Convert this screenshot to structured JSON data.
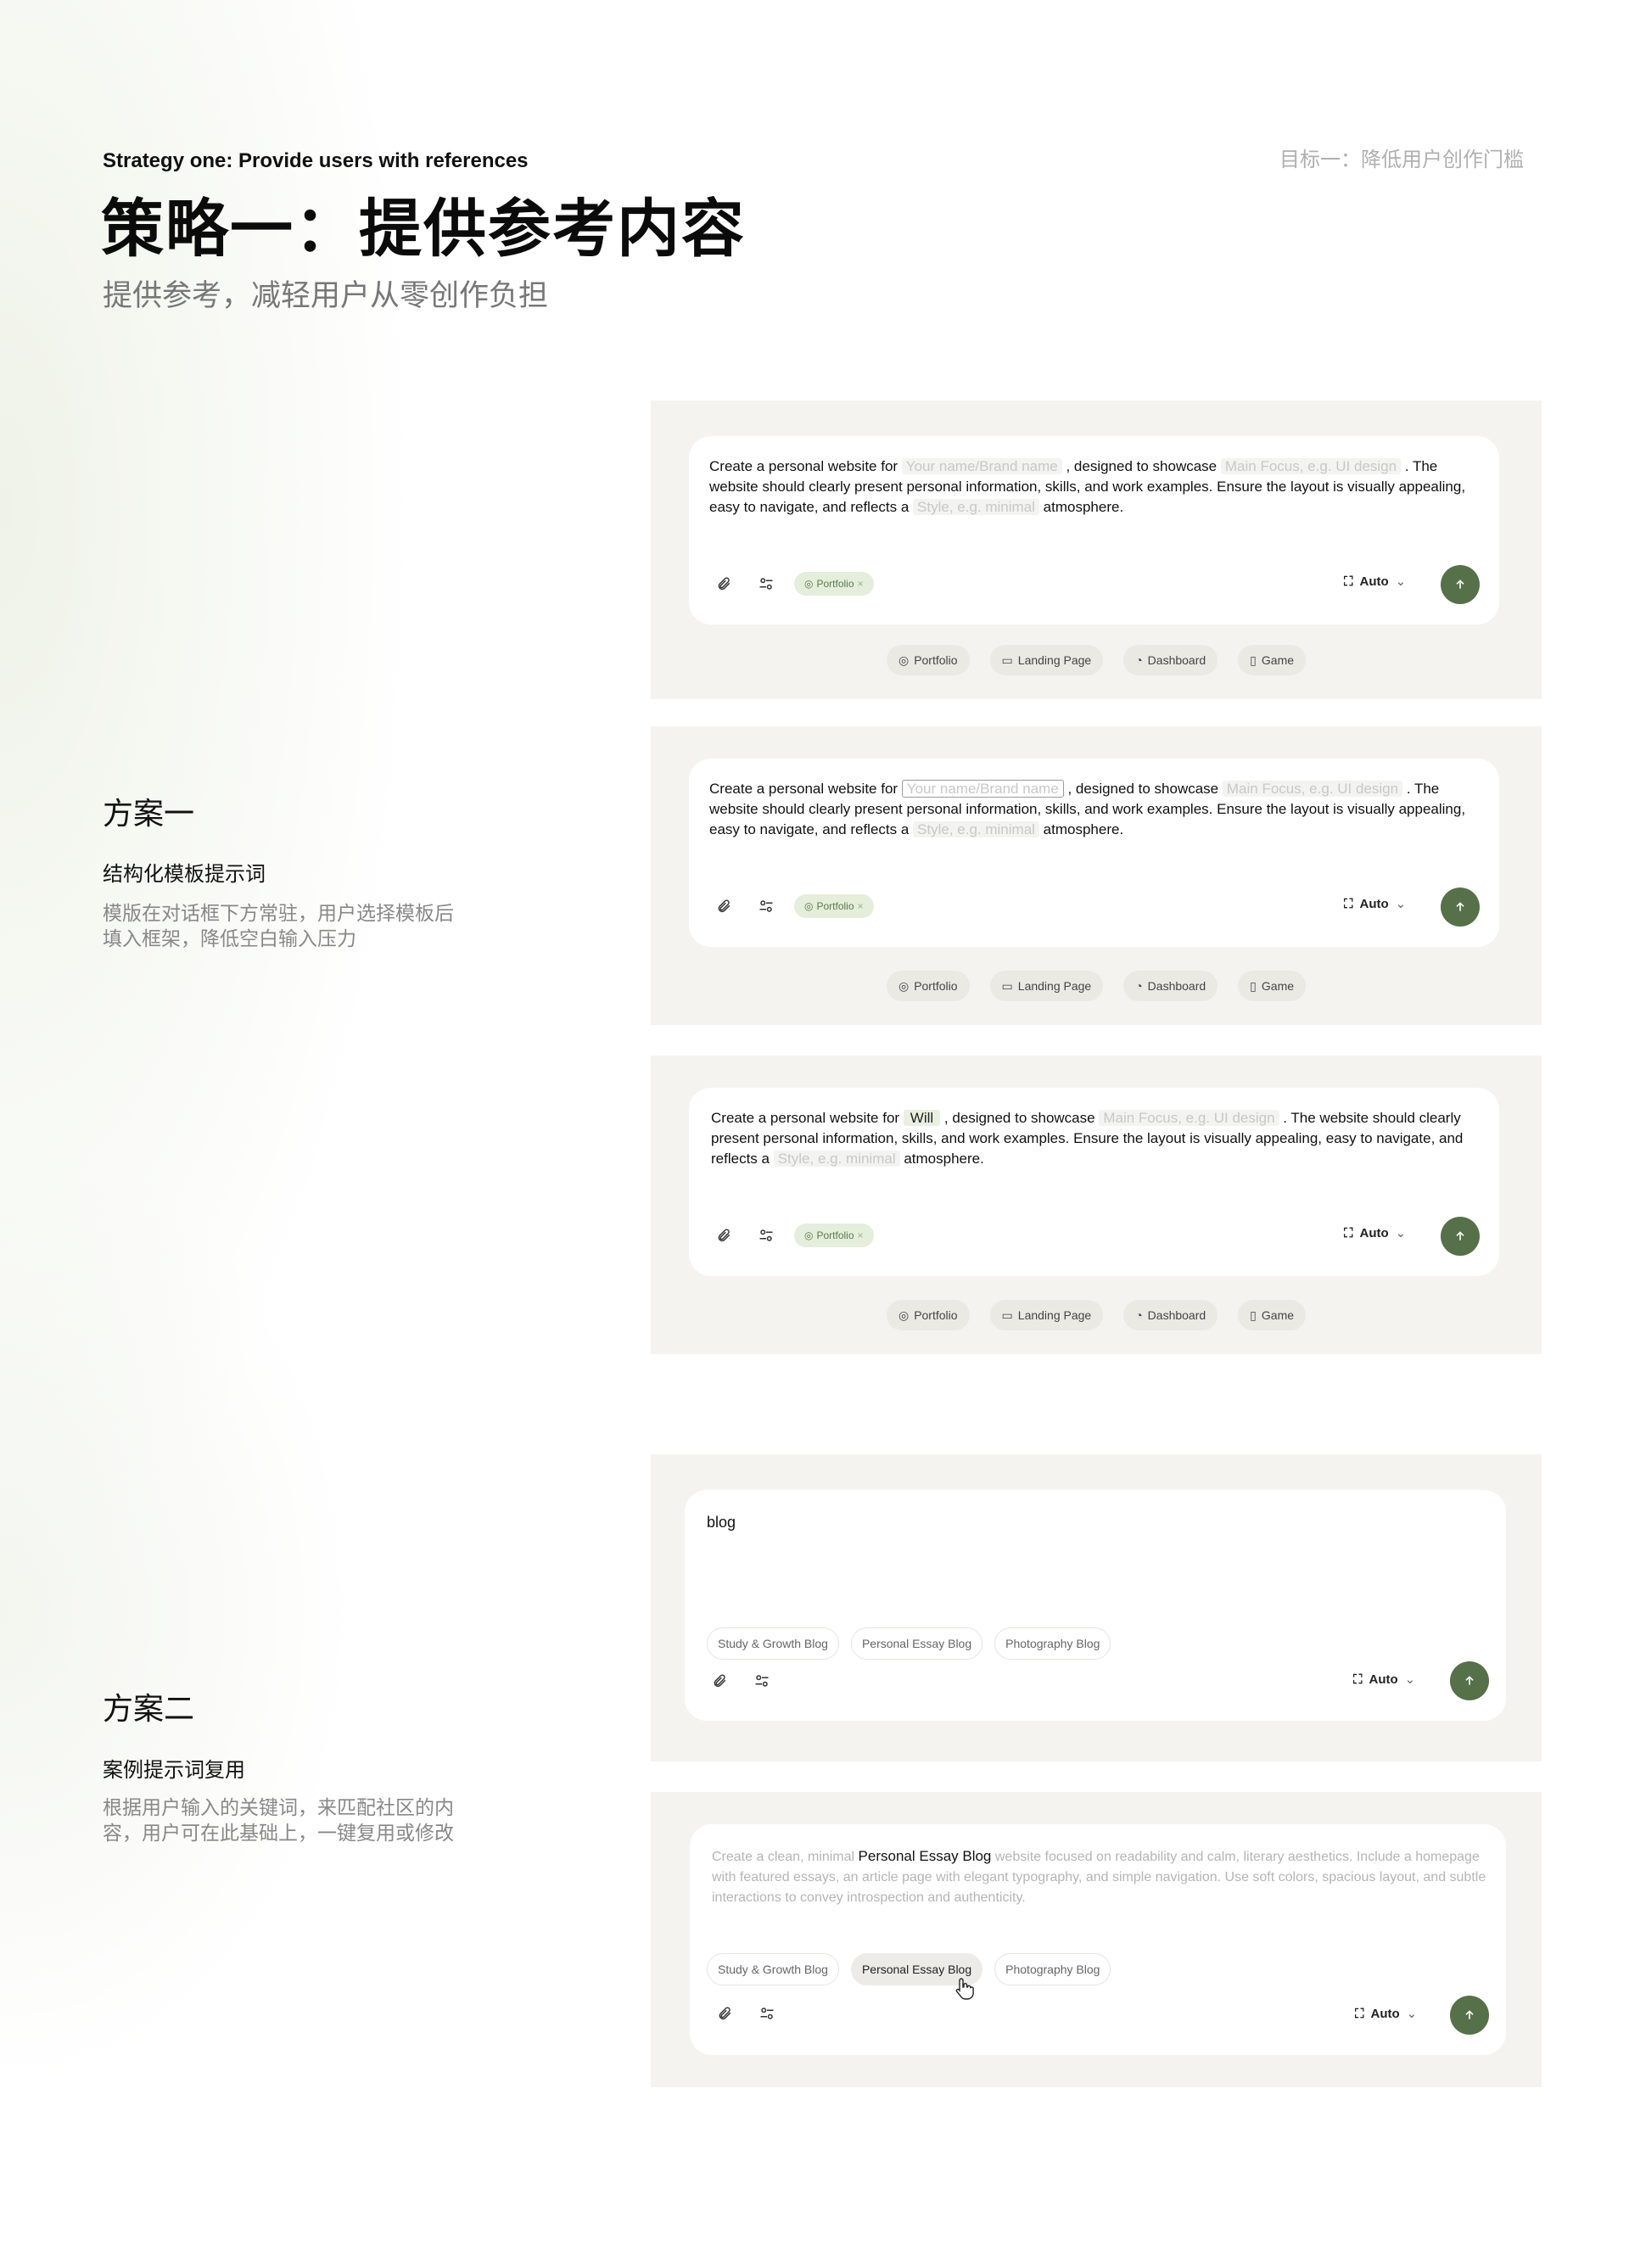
{
  "header": {
    "subtitle_en": "Strategy one: Provide users with references",
    "title": "策略一：提供参考内容",
    "intro": "提供参考，减轻用户从零创作负担",
    "goal": "目标一：降低用户创作门槛"
  },
  "plan1": {
    "title": "方案一",
    "subtitle": "结构化模板提示词",
    "desc_line1": "模版在对话框下方常驻，用户选择模板后",
    "desc_line2": "填入框架，降低空白输入压力"
  },
  "plan2": {
    "title": "方案二",
    "subtitle": "案例提示词复用",
    "desc_line1": "根据用户输入的关键词，来匹配社区的内",
    "desc_line2": "容，用户可在此基础上，一键复用或修改"
  },
  "prompt": {
    "part1": "Create a personal website for",
    "part2": ", designed to showcase",
    "part3": ". The website should clearly present personal information, skills, and work examples. Ensure the layout is visually appealing, easy to navigate, and reflects a",
    "part4": "atmosphere.",
    "slot_name": "Your name/Brand name",
    "slot_focus": "Main Focus, e.g. UI design",
    "slot_style": "Style,   e.g. minimal",
    "filled_name": "Will"
  },
  "controls": {
    "tag": "Portfolio",
    "tag_close": "×",
    "model": "Auto"
  },
  "templates": [
    "Portfolio",
    "Landing Page",
    "Dashboard",
    "Game"
  ],
  "search": {
    "query": "blog",
    "suggestions": [
      "Study & Growth Blog",
      "Personal Essay Blog",
      "Photography Blog"
    ],
    "preview_before": "Create a clean, minimal",
    "preview_highlight": "Personal Essay Blog",
    "preview_after": "website focused on readability and calm, literary aesthetics. Include a homepage with featured essays, an article page with elegant typography, and simple navigation. Use soft colors, spacious layout, and subtle interactions to convey introspection and authenticity."
  },
  "colors": {
    "accent_green": "#56704a",
    "tag_bg": "#e4eedb",
    "panel_bg": "#f4f3ef"
  },
  "icons": [
    "paperclip-icon",
    "settings-sliders-icon",
    "portfolio-icon",
    "model-icon",
    "chevron-down-icon",
    "arrow-up-icon",
    "landing-page-icon",
    "dashboard-icon",
    "game-icon",
    "hand-cursor-icon"
  ]
}
